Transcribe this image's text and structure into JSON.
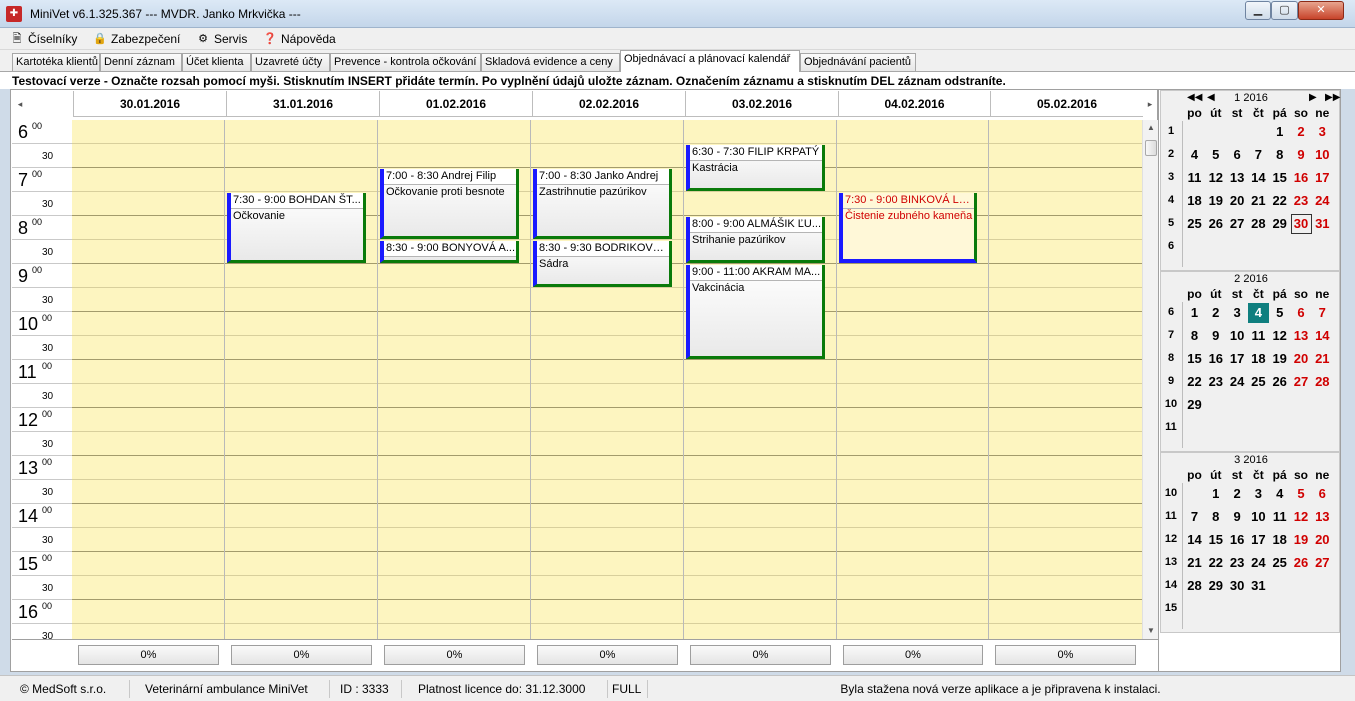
{
  "window": {
    "title": "MiniVet v6.1.325.367 --- MVDR. Janko Mrkvička ---",
    "icon": "app-logo-icon",
    "controls": {
      "minimize": "▁",
      "maximize": "▢",
      "close": "✕"
    }
  },
  "menu": [
    {
      "label": "Číselníky",
      "icon": "document-icon",
      "glyph": "🗎"
    },
    {
      "label": "Zabezpečení",
      "icon": "lock-icon",
      "glyph": "🔒"
    },
    {
      "label": "Servis",
      "icon": "wrench-icon",
      "glyph": "⚙"
    },
    {
      "label": "Nápověda",
      "icon": "help-icon",
      "glyph": "❓"
    }
  ],
  "tabs": [
    {
      "label": "Kartotéka klientů",
      "active": false
    },
    {
      "label": "Denní záznam",
      "active": false
    },
    {
      "label": "Účet klienta",
      "active": false
    },
    {
      "label": "Uzavreté účty",
      "active": false
    },
    {
      "label": "Prevence - kontrola očkování",
      "active": false
    },
    {
      "label": "Skladová evidence a ceny",
      "active": false
    },
    {
      "label": "Objednávací a plánovací kalendář",
      "active": true
    },
    {
      "label": "Objednávání pacientů",
      "active": false
    }
  ],
  "info_text": "Testovací verze - Označte rozsah pomocí myši. Stisknutím INSERT přidáte termín. Po vyplnění údajů uložte záznam. Označením záznamu a stisknutím DEL záznam odstraníte.",
  "calendar": {
    "nav_left": "◂",
    "nav_right": "▸",
    "days": [
      "30.01.2016",
      "31.01.2016",
      "01.02.2016",
      "02.02.2016",
      "03.02.2016",
      "04.02.2016",
      "05.02.2016"
    ],
    "hours": [
      "6",
      "7",
      "8",
      "9",
      "10",
      "11",
      "12",
      "13",
      "14",
      "15",
      "16"
    ],
    "minutes_full": "00",
    "minutes_half": "30",
    "events": [
      {
        "day": 1,
        "start": 7.5,
        "end": 9.0,
        "title": "7:30 - 9:00 BOHDAN ŠT...",
        "desc": "Očkovanie",
        "selected": false
      },
      {
        "day": 2,
        "start": 7.0,
        "end": 8.5,
        "title": "7:00 - 8:30 Andrej Filip",
        "desc": "Očkovanie proti besnote",
        "selected": false
      },
      {
        "day": 2,
        "start": 8.5,
        "end": 9.0,
        "title": "8:30 - 9:00 BONYOVÁ A...",
        "desc": "",
        "selected": false
      },
      {
        "day": 3,
        "start": 7.0,
        "end": 8.5,
        "title": "7:00 - 8:30 Janko Andrej",
        "desc": "Zastrihnutie pazúrikov",
        "selected": false
      },
      {
        "day": 3,
        "start": 8.5,
        "end": 9.5,
        "title": "8:30 - 9:30 BODRIKOVÁ ...",
        "desc": "Sádra",
        "selected": false
      },
      {
        "day": 4,
        "start": 6.5,
        "end": 7.5,
        "title": "6:30 - 7:30 FILIP KRPATÝ",
        "desc": "Kastrácia",
        "selected": false
      },
      {
        "day": 4,
        "start": 8.0,
        "end": 9.0,
        "title": "8:00 - 9:00 ALMÁŠIK ĽU...",
        "desc": "Strihanie pazúrikov",
        "selected": false
      },
      {
        "day": 4,
        "start": 9.0,
        "end": 11.0,
        "title": "9:00 - 11:00 AKRAM MA...",
        "desc": "Vakcinácia",
        "selected": false
      },
      {
        "day": 5,
        "start": 7.5,
        "end": 9.0,
        "title": "7:30 - 9:00 BINKOVÁ LE...",
        "desc": "Čistenie zubného kameňa",
        "selected": true
      }
    ],
    "progress": [
      "0%",
      "0%",
      "0%",
      "0%",
      "0%",
      "0%",
      "0%"
    ]
  },
  "mini_calendars": {
    "nav_glyphs": {
      "prev_year": "◀◀",
      "prev_month": "◀",
      "next_month": "▶",
      "next_year": "▶▶"
    },
    "weekday_names": [
      "po",
      "út",
      "st",
      "čt",
      "pá",
      "so",
      "ne"
    ],
    "months": [
      {
        "title": "1 2016",
        "show_nav": true,
        "weeks": [
          {
            "num": "1",
            "days": [
              "",
              "",
              "",
              "",
              "1",
              "2",
              "3"
            ]
          },
          {
            "num": "2",
            "days": [
              "4",
              "5",
              "6",
              "7",
              "8",
              "9",
              "10"
            ]
          },
          {
            "num": "3",
            "days": [
              "11",
              "12",
              "13",
              "14",
              "15",
              "16",
              "17"
            ]
          },
          {
            "num": "4",
            "days": [
              "18",
              "19",
              "20",
              "21",
              "22",
              "23",
              "24"
            ]
          },
          {
            "num": "5",
            "days": [
              "25",
              "26",
              "27",
              "28",
              "29",
              "30",
              "31"
            ]
          },
          {
            "num": "6",
            "days": [
              "",
              "",
              "",
              "",
              "",
              "",
              ""
            ]
          }
        ],
        "marked": "30",
        "today": ""
      },
      {
        "title": "2 2016",
        "show_nav": false,
        "weeks": [
          {
            "num": "6",
            "days": [
              "1",
              "2",
              "3",
              "4",
              "5",
              "6",
              "7"
            ]
          },
          {
            "num": "7",
            "days": [
              "8",
              "9",
              "10",
              "11",
              "12",
              "13",
              "14"
            ]
          },
          {
            "num": "8",
            "days": [
              "15",
              "16",
              "17",
              "18",
              "19",
              "20",
              "21"
            ]
          },
          {
            "num": "9",
            "days": [
              "22",
              "23",
              "24",
              "25",
              "26",
              "27",
              "28"
            ]
          },
          {
            "num": "10",
            "days": [
              "29",
              "",
              "",
              "",
              "",
              "",
              ""
            ]
          },
          {
            "num": "11",
            "days": [
              "",
              "",
              "",
              "",
              "",
              "",
              ""
            ]
          }
        ],
        "marked": "",
        "today": "4"
      },
      {
        "title": "3 2016",
        "show_nav": false,
        "weeks": [
          {
            "num": "10",
            "days": [
              "",
              "1",
              "2",
              "3",
              "4",
              "5",
              "6"
            ]
          },
          {
            "num": "11",
            "days": [
              "7",
              "8",
              "9",
              "10",
              "11",
              "12",
              "13"
            ]
          },
          {
            "num": "12",
            "days": [
              "14",
              "15",
              "16",
              "17",
              "18",
              "19",
              "20"
            ]
          },
          {
            "num": "13",
            "days": [
              "21",
              "22",
              "23",
              "24",
              "25",
              "26",
              "27"
            ]
          },
          {
            "num": "14",
            "days": [
              "28",
              "29",
              "30",
              "31",
              "",
              "",
              ""
            ]
          },
          {
            "num": "15",
            "days": [
              "",
              "",
              "",
              "",
              "",
              "",
              ""
            ]
          }
        ],
        "marked": "",
        "today": ""
      }
    ]
  },
  "status": [
    "© MedSoft s.r.o.",
    "Veterinární ambulance MiniVet",
    "ID : 3333",
    "Platnost licence do: 31.12.3000",
    "FULL",
    "Byla stažena nová verze aplikace a je připravena k instalaci."
  ],
  "colors": {
    "grid_background": "#fdf5c0",
    "event_left_border": "#1a1aff",
    "event_bottom_border": "#0a7a0a",
    "selected_event_text": "#d00000",
    "today_highlight": "#0f7f7f",
    "weekend_text": "#d00000"
  }
}
